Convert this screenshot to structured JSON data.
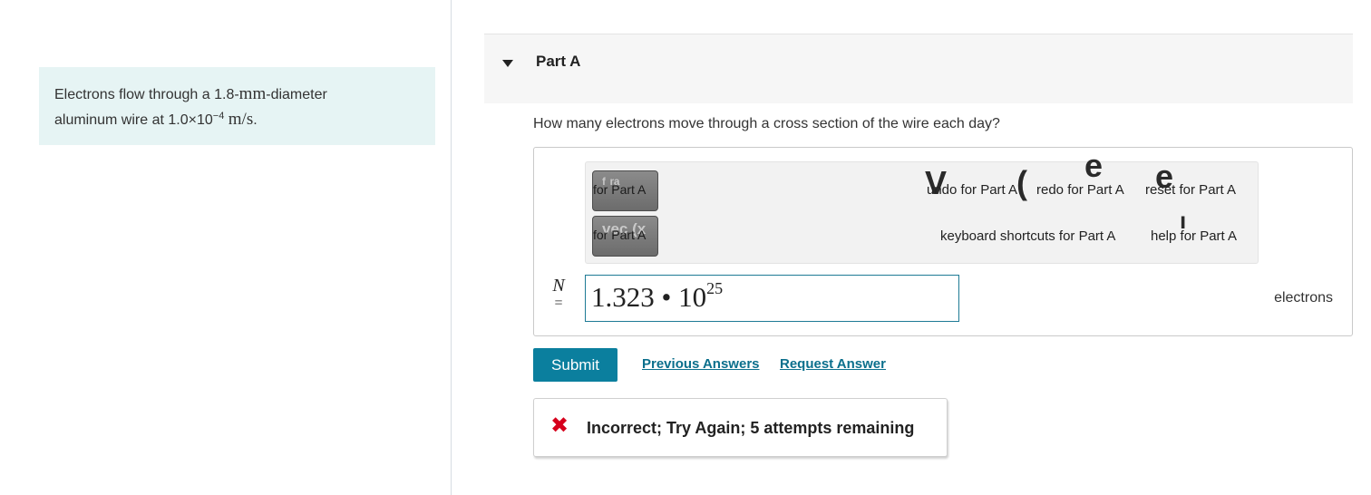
{
  "problem": {
    "text_before": "Electrons flow through a 1.8-",
    "unit_mm": "mm",
    "text_mid": "-diameter",
    "text_line2": "aluminum wire at 1.0×10",
    "exponent": "−4",
    "unit_speed": "m/s",
    "period": "."
  },
  "part": {
    "title": "Part A",
    "question": "How many electrons move through a cross section of the wire each day?"
  },
  "toolbar": {
    "button1_ghost": "ᶠ ʳᵃ",
    "button1_label": "for Part A",
    "button2_ghost": "vec (x",
    "button2_label": "for Part A",
    "undo": "undo for Part A",
    "redo": "redo for Part A",
    "reset": "reset for Part A",
    "keyboard": "keyboard shortcuts for Part A",
    "help": "help for Part A",
    "glyph_undo": "V",
    "glyph_redo": "(",
    "glyph_reset": "e",
    "glyph_reset2": "e",
    "glyph_help": "ı"
  },
  "answer": {
    "variable": "N",
    "equals": "=",
    "value_mantissa": "1.323 • 10",
    "value_exponent": "25",
    "unit": "electrons"
  },
  "actions": {
    "submit": "Submit",
    "previous_answers": "Previous Answers",
    "request_answer": "Request Answer"
  },
  "feedback": {
    "icon": "✖",
    "message": "Incorrect; Try Again; 5 attempts remaining"
  }
}
